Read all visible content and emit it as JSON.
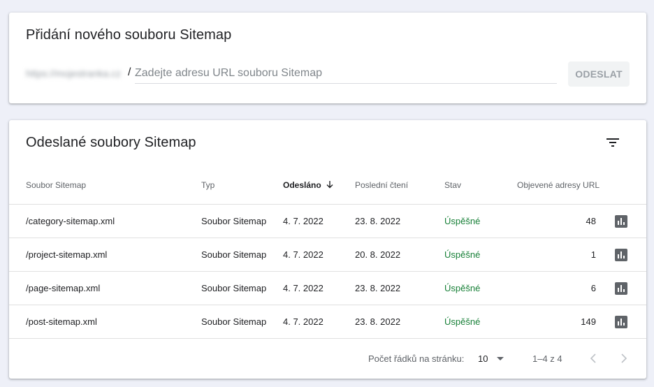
{
  "add_sitemap": {
    "title": "Přidání nového souboru Sitemap",
    "domain_prefix": "https://mojestranka.cz",
    "slash": "/",
    "input_placeholder": "Zadejte adresu URL souboru Sitemap",
    "input_value": "",
    "submit_label": "ODESLAT"
  },
  "submitted": {
    "title": "Odeslané soubory Sitemap",
    "filter_icon": "filter-list-icon",
    "columns": {
      "file": "Soubor Sitemap",
      "type": "Typ",
      "sent": "Odesláno",
      "last_read": "Poslední čtení",
      "status": "Stav",
      "urls": "Objevené adresy URL"
    },
    "sorted_by": "sent",
    "sort_direction": "desc",
    "rows": [
      {
        "file": "/category-sitemap.xml",
        "type": "Soubor Sitemap",
        "sent": "4. 7. 2022",
        "last_read": "23. 8. 2022",
        "status": "Úspěšné",
        "urls": "48"
      },
      {
        "file": "/project-sitemap.xml",
        "type": "Soubor Sitemap",
        "sent": "4. 7. 2022",
        "last_read": "20. 8. 2022",
        "status": "Úspěšné",
        "urls": "1"
      },
      {
        "file": "/page-sitemap.xml",
        "type": "Soubor Sitemap",
        "sent": "4. 7. 2022",
        "last_read": "23. 8. 2022",
        "status": "Úspěšné",
        "urls": "6"
      },
      {
        "file": "/post-sitemap.xml",
        "type": "Soubor Sitemap",
        "sent": "4. 7. 2022",
        "last_read": "23. 8. 2022",
        "status": "Úspěšné",
        "urls": "149"
      }
    ],
    "pagination": {
      "rows_per_page_label": "Počet řádků na stránku:",
      "rows_per_page": "10",
      "range": "1–4 z 4"
    }
  },
  "colors": {
    "background": "#eef0f8",
    "success": "#188038",
    "icon": "#5f6368"
  }
}
